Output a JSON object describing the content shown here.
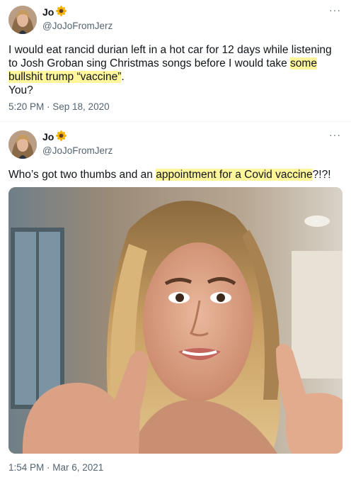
{
  "tweets": [
    {
      "name": "Jo",
      "name_emoji": "sunflower-icon",
      "handle": "@JoJoFromJerz",
      "text_before": "I would eat rancid durian left in a hot car for 12 days while listening to Josh Groban sing Christmas songs before I would take ",
      "text_highlight": "some bullshit trump “vaccine”",
      "text_after": ".",
      "text_line2": "You?",
      "timestamp": "5:20 PM · Sep 18, 2020"
    },
    {
      "name": "Jo",
      "name_emoji": "sunflower-icon",
      "handle": "@JoJoFromJerz",
      "text_before": "Who’s got two thumbs and an ",
      "text_highlight": "appointment for a Covid vaccine",
      "text_after": "?!?!",
      "media": "photo",
      "timestamp": "1:54 PM · Mar 6, 2021"
    }
  ],
  "more_label": "···",
  "colors": {
    "highlight": "#fff59a",
    "secondary_text": "#536471",
    "primary_text": "#0f1419"
  }
}
